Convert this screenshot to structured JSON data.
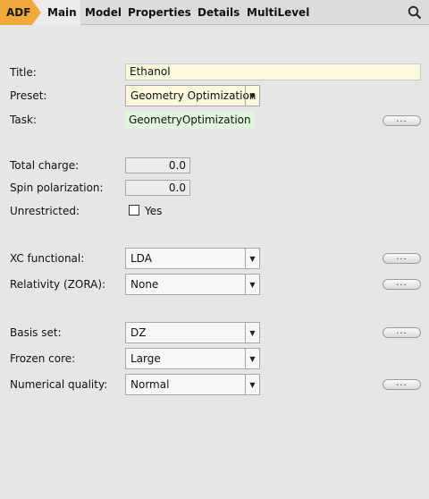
{
  "tabbar": {
    "app_badge": "ADF",
    "tabs": [
      "Main",
      "Model",
      "Properties",
      "Details",
      "MultiLevel"
    ]
  },
  "form": {
    "title_label": "Title:",
    "title_value": "Ethanol",
    "preset_label": "Preset:",
    "preset_value": "Geometry Optimization",
    "task_label": "Task:",
    "task_value": "GeometryOptimization",
    "charge_label": "Total charge:",
    "charge_value": "0.0",
    "spin_label": "Spin polarization:",
    "spin_value": "0.0",
    "unrestricted_label": "Unrestricted:",
    "unrestricted_checkbox_label": "Yes",
    "xc_label": "XC functional:",
    "xc_value": "LDA",
    "relativity_label": "Relativity (ZORA):",
    "relativity_value": "None",
    "basis_label": "Basis set:",
    "basis_value": "DZ",
    "frozen_label": "Frozen core:",
    "frozen_value": "Large",
    "quality_label": "Numerical quality:",
    "quality_value": "Normal",
    "more_label": "..."
  },
  "colors": {
    "adf_badge": "#f2a93b",
    "input_highlight": "#fcf8dc",
    "task_highlight": "#dff5dc",
    "background": "#e6e6e6"
  }
}
